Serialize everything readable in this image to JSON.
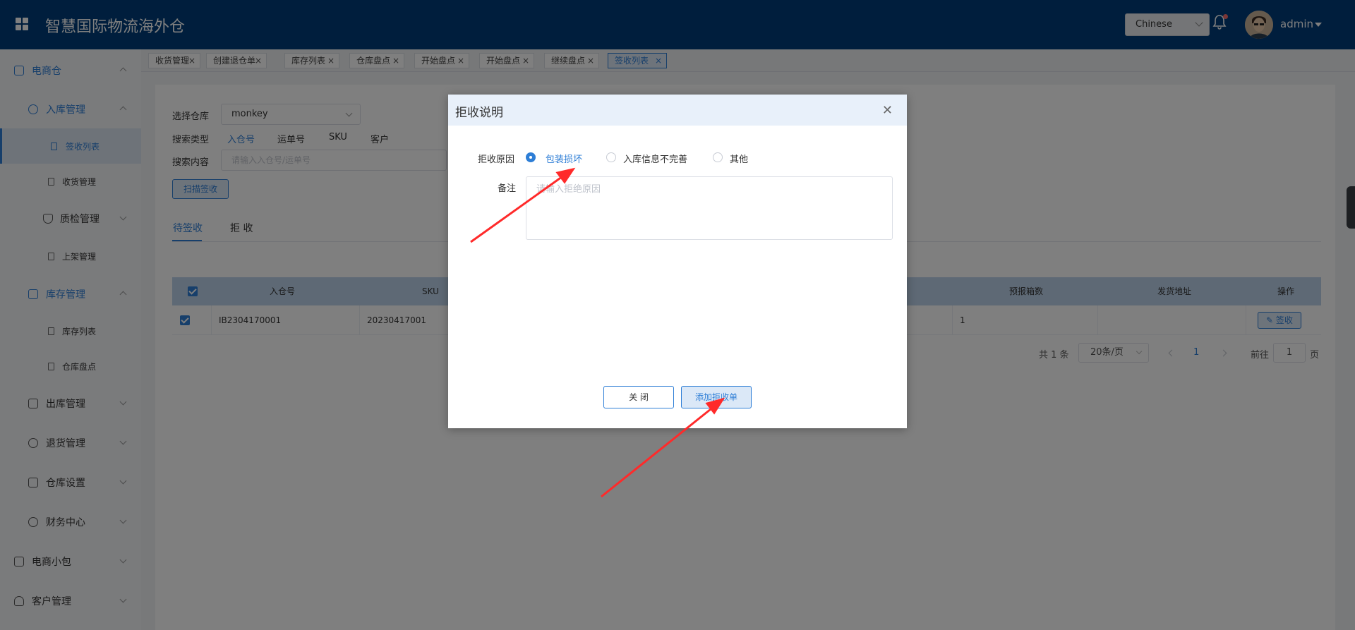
{
  "header": {
    "app_title": "智慧国际物流海外仓",
    "language": "Chinese",
    "user_name": "admin",
    "icons": [
      "grid-icon",
      "bell-icon",
      "avatar"
    ]
  },
  "sidebar": {
    "items": [
      {
        "label": "电商仓",
        "icon": "mail-icon",
        "expanded": true
      },
      {
        "label": "入库管理",
        "icon": "inbound-icon",
        "expanded": true
      },
      {
        "label": "签收列表",
        "icon": "doc-icon",
        "active": true
      },
      {
        "label": "收货管理",
        "icon": "doc-icon"
      },
      {
        "label": "质检管理",
        "icon": "shield-icon",
        "expanded": false
      },
      {
        "label": "上架管理",
        "icon": "doc-icon"
      },
      {
        "label": "库存管理",
        "icon": "box-icon",
        "expanded": true
      },
      {
        "label": "库存列表",
        "icon": "doc-icon"
      },
      {
        "label": "仓库盘点",
        "icon": "doc-icon"
      },
      {
        "label": "出库管理",
        "icon": "home-icon",
        "expanded": false
      },
      {
        "label": "退货管理",
        "icon": "return-icon",
        "expanded": false
      },
      {
        "label": "仓库设置",
        "icon": "warehouse-icon",
        "expanded": false
      },
      {
        "label": "财务中心",
        "icon": "finance-icon",
        "expanded": false
      },
      {
        "label": "电商小包",
        "icon": "package-icon",
        "expanded": false
      },
      {
        "label": "客户管理",
        "icon": "user-icon",
        "expanded": false
      }
    ]
  },
  "tabs": [
    {
      "label": "收货管理"
    },
    {
      "label": "创建退仓单"
    },
    {
      "label": "库存列表"
    },
    {
      "label": "仓库盘点"
    },
    {
      "label": "开始盘点"
    },
    {
      "label": "开始盘点"
    },
    {
      "label": "继续盘点"
    },
    {
      "label": "签收列表",
      "active": true
    }
  ],
  "filters": {
    "warehouse_label": "选择仓库",
    "warehouse_value": "monkey",
    "search_type_label": "搜索类型",
    "search_types": [
      "入仓号",
      "运单号",
      "SKU",
      "客户"
    ],
    "search_type_selected": "入仓号",
    "search_content_label": "搜索内容",
    "search_placeholder": "请输入入仓号/运单号",
    "scan_button": "扫描签收"
  },
  "subtabs": {
    "pending": "待签收",
    "rejected": "拒 收"
  },
  "table": {
    "headers": [
      "入仓号",
      "SKU",
      "预报箱数",
      "发货地址",
      "操作"
    ],
    "rows": [
      {
        "inbound_no": "IB2304170001",
        "sku": "20230417001",
        "forecast_boxes": "1",
        "ship_address": "",
        "action": "签收",
        "checked": true
      }
    ]
  },
  "pagination": {
    "total": "共 1 条",
    "page_size": "20条/页",
    "current_page": "1",
    "goto_label": "前往",
    "goto_value": "1",
    "page_suffix": "页"
  },
  "modal": {
    "title": "拒收说明",
    "reason_label": "拒收原因",
    "reasons": [
      "包装损坏",
      "入库信息不完善",
      "其他"
    ],
    "selected_reason": "包装损坏",
    "remark_label": "备注",
    "remark_placeholder": "请输入拒绝原因",
    "close_button": "关 闭",
    "submit_button": "添加拒收单"
  },
  "colors": {
    "header_bg": "#003d7a",
    "accent": "#2e7ed6",
    "annotation_arrow": "#ff2a2a"
  }
}
